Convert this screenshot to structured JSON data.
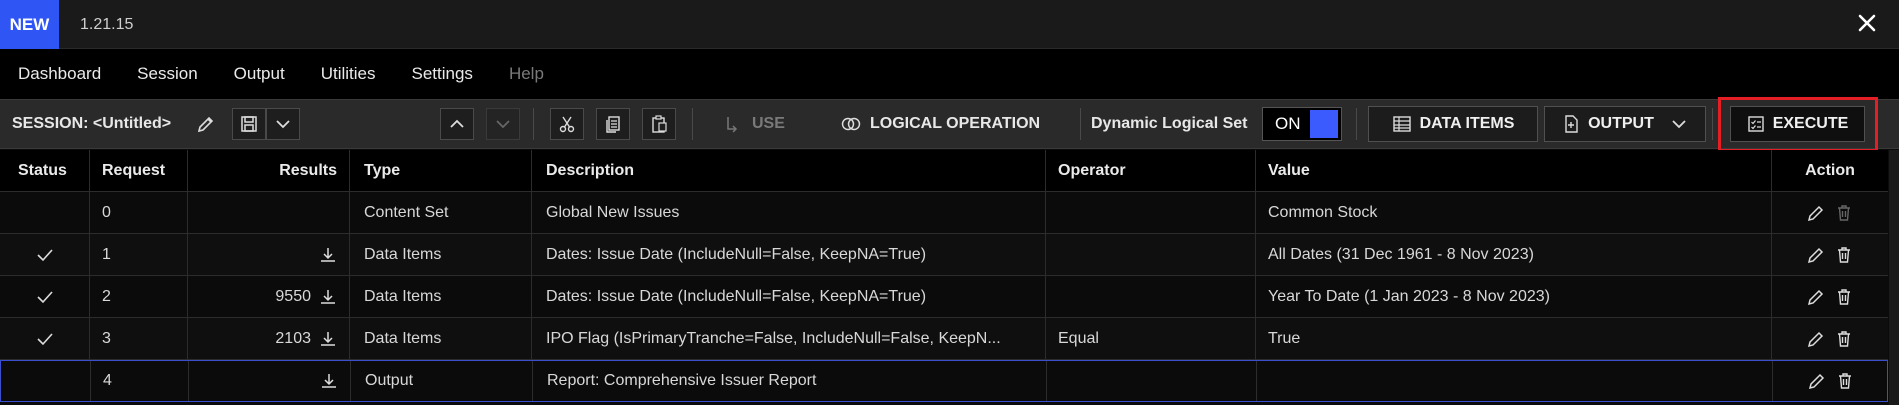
{
  "titlebar": {
    "badge": "NEW",
    "version": "1.21.15"
  },
  "menu": [
    {
      "label": "Dashboard",
      "enabled": true
    },
    {
      "label": "Session",
      "enabled": true
    },
    {
      "label": "Output",
      "enabled": true
    },
    {
      "label": "Utilities",
      "enabled": true
    },
    {
      "label": "Settings",
      "enabled": true
    },
    {
      "label": "Help",
      "enabled": false
    }
  ],
  "toolbar": {
    "session_label": "SESSION: <Untitled>",
    "use_label": "USE",
    "logical_operation_label": "LOGICAL OPERATION",
    "dynamic_logical_set_label": "Dynamic Logical Set",
    "toggle_state": "ON",
    "data_items_label": "DATA ITEMS",
    "output_label": "OUTPUT",
    "execute_label": "EXECUTE"
  },
  "table": {
    "headers": [
      "Status",
      "Request",
      "Results",
      "Type",
      "Description",
      "Operator",
      "Value",
      "Action"
    ],
    "rows": [
      {
        "status": "",
        "request": "0",
        "results": "",
        "type": "Content Set",
        "description": "Global New Issues",
        "operator": "",
        "value": "Common Stock"
      },
      {
        "status": "check",
        "request": "1",
        "results": "",
        "type": "Data Items",
        "description": "Dates: Issue Date (IncludeNull=False, KeepNA=True)",
        "operator": "",
        "value": "All Dates (31 Dec 1961 - 8 Nov 2023)"
      },
      {
        "status": "check",
        "request": "2",
        "results": "9550",
        "type": "Data Items",
        "description": "Dates: Issue Date (IncludeNull=False, KeepNA=True)",
        "operator": "",
        "value": "Year To Date (1 Jan 2023 - 8 Nov 2023)"
      },
      {
        "status": "check",
        "request": "3",
        "results": "2103",
        "type": "Data Items",
        "description": "IPO Flag (IsPrimaryTranche=False, IncludeNull=False, KeepN...",
        "operator": "Equal",
        "value": "True"
      },
      {
        "status": "",
        "request": "4",
        "results": "",
        "type": "Output",
        "description": "Report: Comprehensive Issuer Report",
        "operator": "",
        "value": ""
      }
    ]
  },
  "colors": {
    "accent": "#2f55f5",
    "highlight": "#e51e25",
    "selected_border": "#3a4ecf"
  }
}
